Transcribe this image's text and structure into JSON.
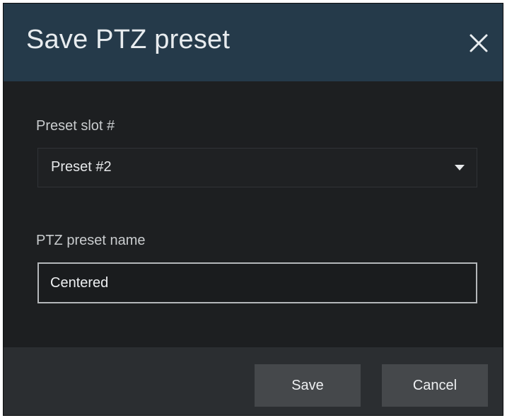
{
  "dialog": {
    "title": "Save PTZ preset",
    "close_icon": "close-icon"
  },
  "form": {
    "slot": {
      "label": "Preset slot #",
      "selected_value": "Preset #2",
      "dropdown_icon": "caret-down-icon"
    },
    "name": {
      "label": "PTZ preset name",
      "value": "Centered"
    }
  },
  "footer": {
    "save_label": "Save",
    "cancel_label": "Cancel"
  },
  "colors": {
    "header_bg": "#253a4a",
    "body_bg": "#1d1f21",
    "footer_bg": "#2b2e31",
    "button_bg": "#45484b"
  }
}
